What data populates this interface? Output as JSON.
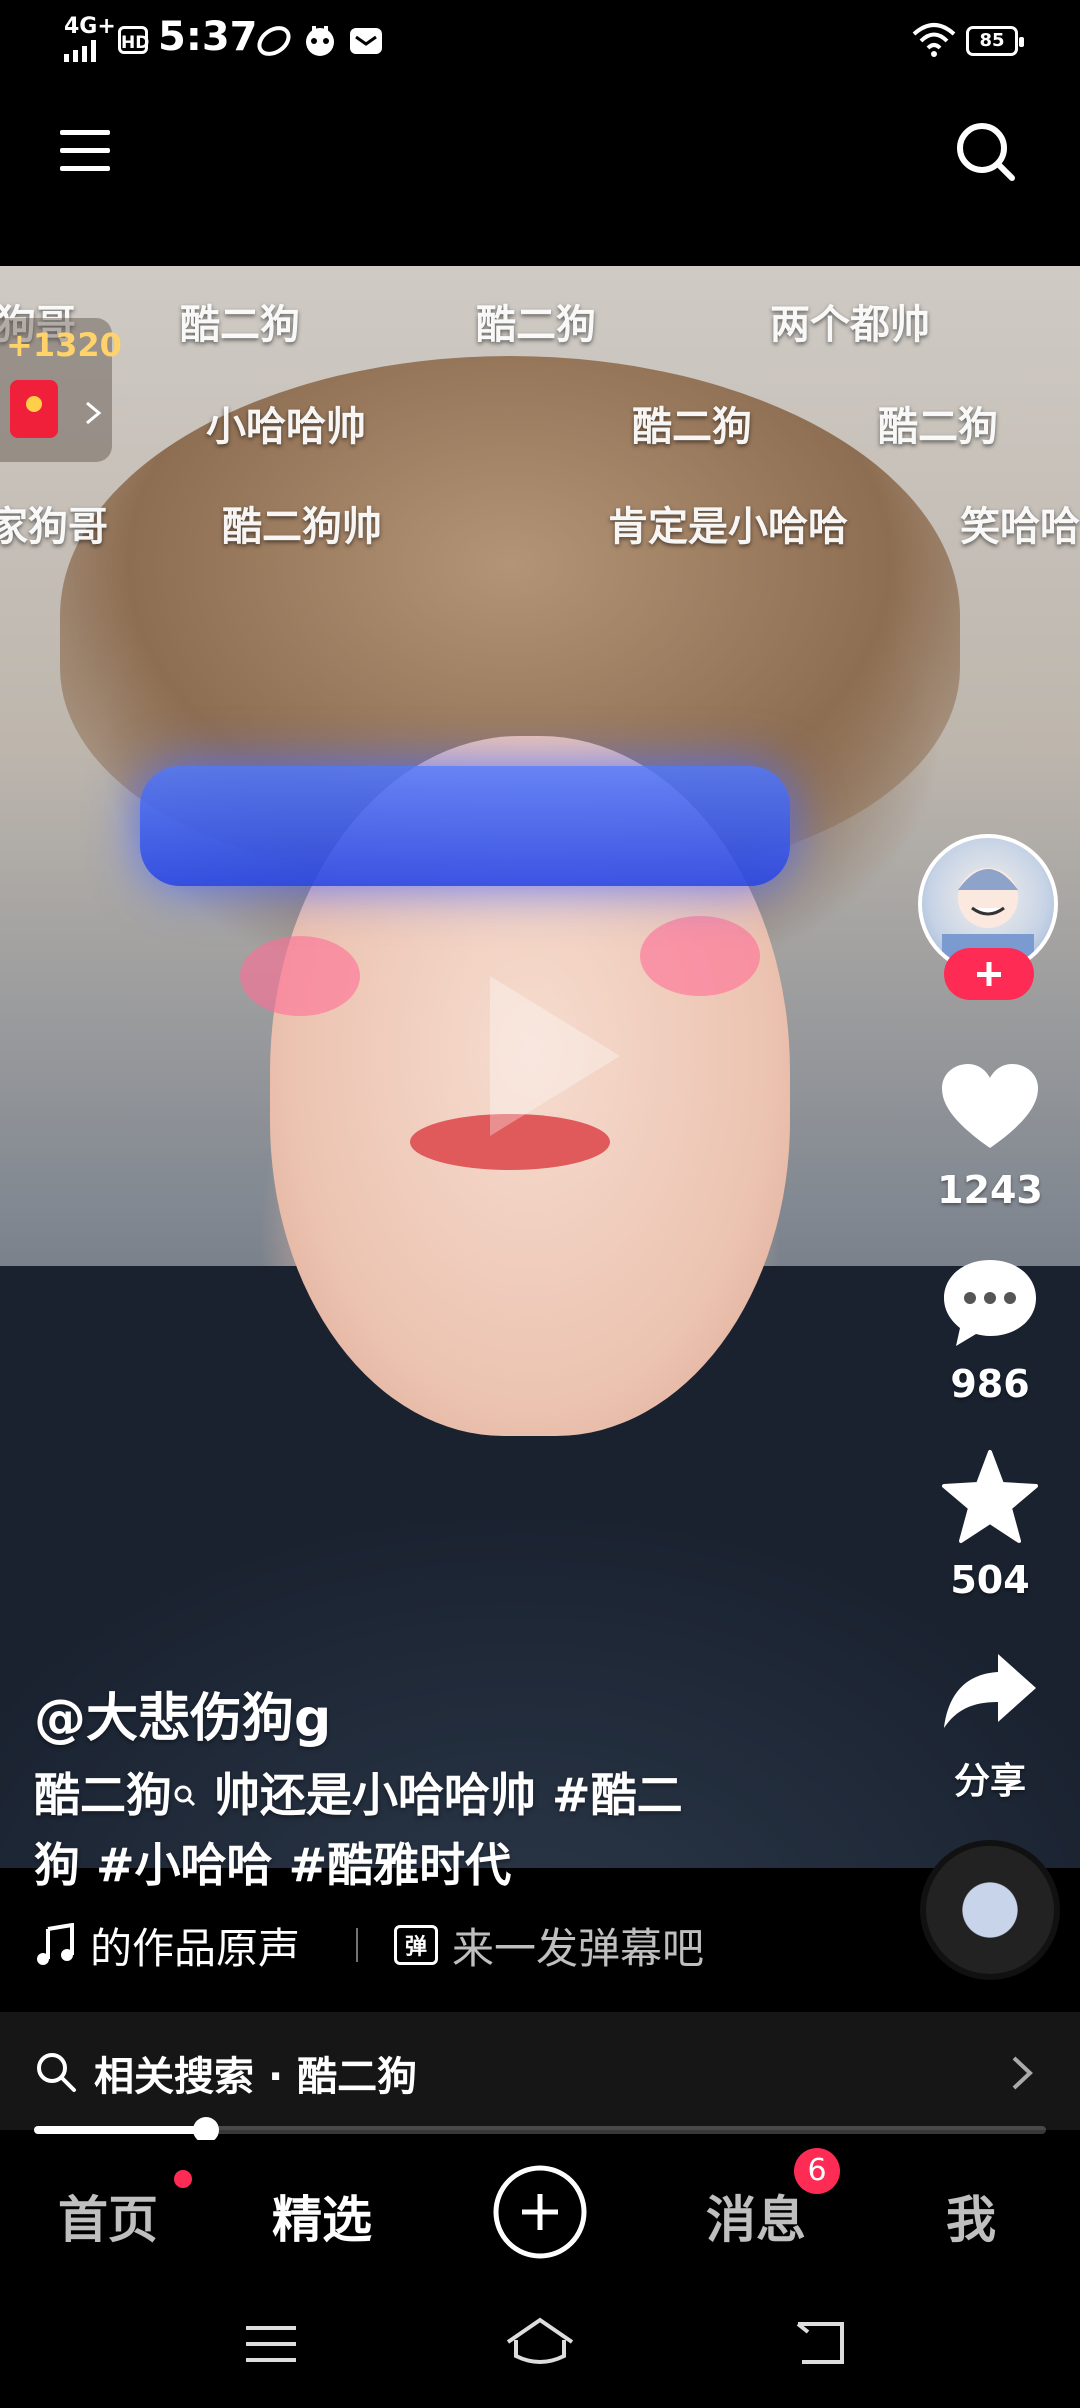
{
  "status_bar": {
    "time": "5:37",
    "network": "4G+",
    "hd": "HD",
    "battery": "85",
    "app_icons": [
      "music-note-icon",
      "robot-face-icon",
      "mail-icon"
    ]
  },
  "top_nav": {
    "menu_icon": "hamburger-menu-icon",
    "search_icon": "search-icon"
  },
  "danmaku": [
    "狗哥",
    "酷二狗",
    "酷二狗",
    "两个都帅",
    "小哈哈帅",
    "酷二狗",
    "酷二狗",
    "家狗哥",
    "酷二狗帅",
    "肯定是小哈哈",
    "笑哈哈"
  ],
  "red_packet": {
    "count": "+1320"
  },
  "actions": {
    "likes": "1243",
    "comments": "986",
    "favorites": "504",
    "share": "分享"
  },
  "post": {
    "author": "@大悲伤狗g",
    "caption_text": "酷二狗",
    "caption_rest": "帅还是小哈哈帅",
    "hashtags": [
      "#酷二",
      "狗",
      "#小哈哈",
      "#酷雅时代"
    ],
    "music": "的作品原声",
    "danmaku_prompt": "来一发弹幕吧",
    "danmaku_icon": "弹"
  },
  "related_search": {
    "prefix": "相关搜索",
    "sep": "·",
    "query": "酷二狗"
  },
  "progress": {
    "fraction": 0.17
  },
  "tabs": {
    "home": "首页",
    "featured": "精选",
    "messages": "消息",
    "messages_badge": "6",
    "me": "我"
  }
}
